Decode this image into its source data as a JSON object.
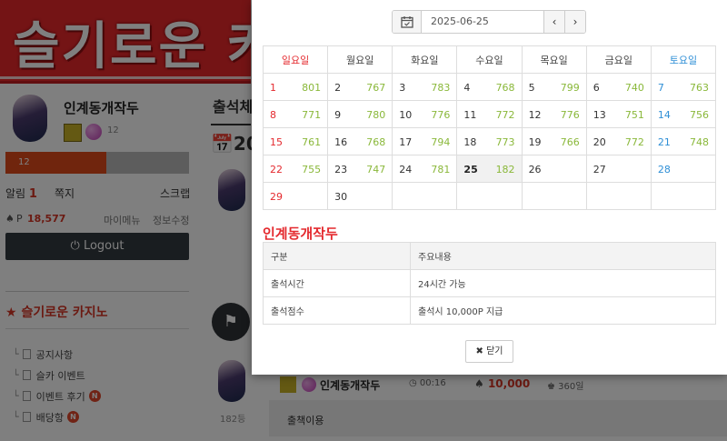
{
  "background": {
    "banner_text": "슬기로운 카",
    "profile": {
      "name": "인계동개작두",
      "level": "12",
      "exp_label": "12",
      "exp_percent": 55
    },
    "menu": {
      "alarm_label": "알림",
      "alarm_count": "1",
      "message_label": "쪽지",
      "scrap_label": "스크랩"
    },
    "points": {
      "label": "P",
      "value": "18,577",
      "mymenu_label": "마이메뉴",
      "edit_label": "정보수정"
    },
    "logout_label": "Logout",
    "section_title": "슬기로운 카지노",
    "nav_items": [
      {
        "label": "공지사항",
        "badge": ""
      },
      {
        "label": "슬카 이벤트",
        "badge": ""
      },
      {
        "label": "이벤트 후기",
        "badge": "N"
      },
      {
        "label": "배당항",
        "badge": "N"
      }
    ],
    "mid_title": "출석체",
    "mid_cal_year": "20",
    "rank_text": "182등",
    "entry": {
      "name": "인계동개작두",
      "time": "00:16",
      "points": "10,000",
      "days": "360일"
    },
    "comment_text": "출책이용"
  },
  "modal": {
    "date_value": "2025-06-25",
    "prev_label": "‹",
    "next_label": "›",
    "weekdays": [
      "일요일",
      "월요일",
      "화요일",
      "수요일",
      "목요일",
      "금요일",
      "토요일"
    ],
    "weeks": [
      [
        {
          "d": "1",
          "v": "801"
        },
        {
          "d": "2",
          "v": "767"
        },
        {
          "d": "3",
          "v": "783"
        },
        {
          "d": "4",
          "v": "768"
        },
        {
          "d": "5",
          "v": "799"
        },
        {
          "d": "6",
          "v": "740"
        },
        {
          "d": "7",
          "v": "763"
        }
      ],
      [
        {
          "d": "8",
          "v": "771"
        },
        {
          "d": "9",
          "v": "780"
        },
        {
          "d": "10",
          "v": "776"
        },
        {
          "d": "11",
          "v": "772"
        },
        {
          "d": "12",
          "v": "776"
        },
        {
          "d": "13",
          "v": "751"
        },
        {
          "d": "14",
          "v": "756"
        }
      ],
      [
        {
          "d": "15",
          "v": "761"
        },
        {
          "d": "16",
          "v": "768"
        },
        {
          "d": "17",
          "v": "794"
        },
        {
          "d": "18",
          "v": "773"
        },
        {
          "d": "19",
          "v": "766"
        },
        {
          "d": "20",
          "v": "772"
        },
        {
          "d": "21",
          "v": "748"
        }
      ],
      [
        {
          "d": "22",
          "v": "755"
        },
        {
          "d": "23",
          "v": "747"
        },
        {
          "d": "24",
          "v": "781"
        },
        {
          "d": "25",
          "v": "182",
          "today": true
        },
        {
          "d": "26",
          "v": ""
        },
        {
          "d": "27",
          "v": ""
        },
        {
          "d": "28",
          "v": ""
        }
      ],
      [
        {
          "d": "29",
          "v": ""
        },
        {
          "d": "30",
          "v": ""
        },
        {
          "d": "",
          "v": ""
        },
        {
          "d": "",
          "v": ""
        },
        {
          "d": "",
          "v": ""
        },
        {
          "d": "",
          "v": ""
        },
        {
          "d": "",
          "v": ""
        }
      ]
    ],
    "info_title": "인계동개작두",
    "info_headers": [
      "구분",
      "주요내용"
    ],
    "info_rows": [
      [
        "출석시간",
        "24시간 가능"
      ],
      [
        "출석점수",
        "출석시 10,000P 지급"
      ]
    ],
    "close_label": "닫기",
    "colors": {
      "sunday": "#e4292e",
      "saturday": "#2f8fd6",
      "count": "#8ab83a",
      "accent": "#e04a1b"
    }
  }
}
